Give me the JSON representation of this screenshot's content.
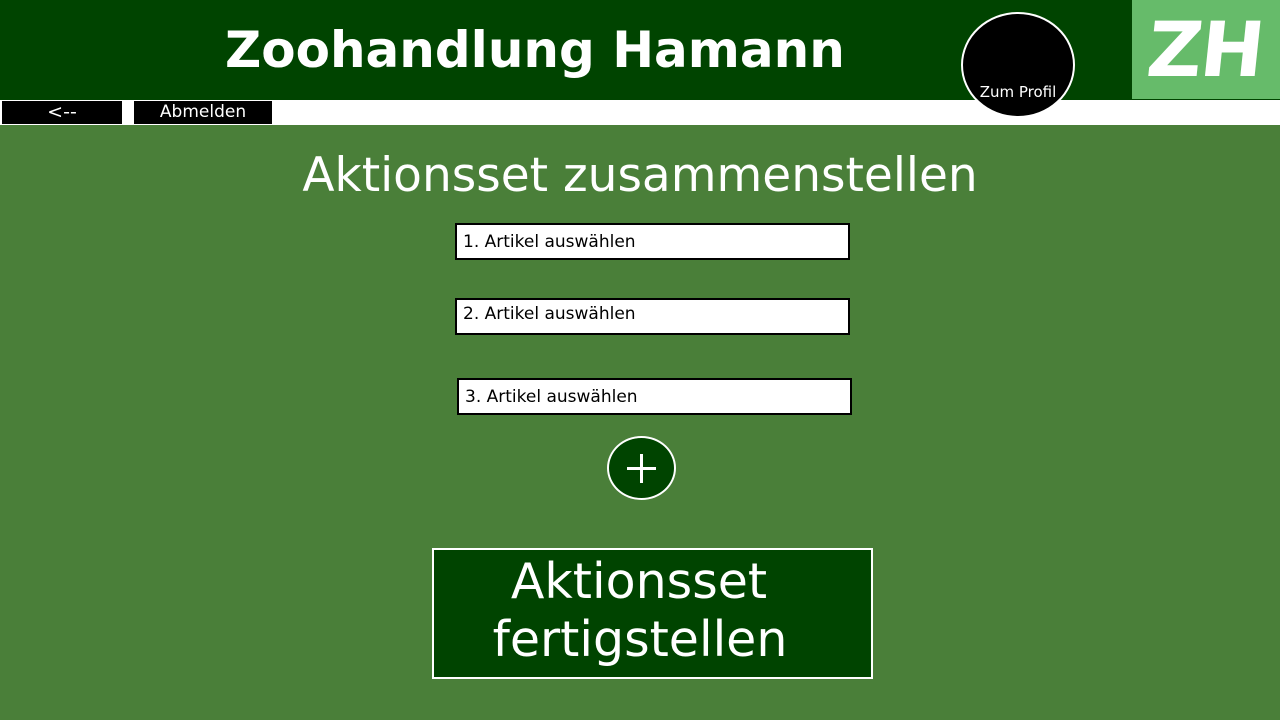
{
  "header": {
    "brand_title": "Zoohandlung Hamann",
    "logo_text": "ZH",
    "profile_label": "Zum Profil"
  },
  "nav": {
    "back_label": "<--",
    "logout_label": "Abmelden"
  },
  "main": {
    "page_title": "Aktionsset zusammenstellen",
    "selects": [
      {
        "label": "1. Artikel auswählen"
      },
      {
        "label": "2. Artikel auswählen"
      },
      {
        "label": "3. Artikel auswählen"
      }
    ],
    "add_icon": "plus-icon",
    "finish_label_line1": "Aktionsset",
    "finish_label_line2": "fertigstellen"
  },
  "colors": {
    "background": "#4a7f39",
    "header": "#004400",
    "logo_accent": "#66bb6a",
    "button_dark": "#000000",
    "action_green": "#004400"
  }
}
